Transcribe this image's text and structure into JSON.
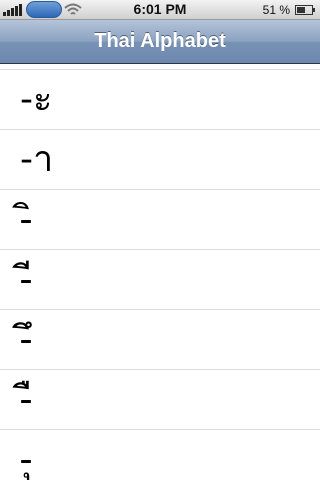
{
  "status_bar": {
    "time": "6:01 PM",
    "battery_percent": "51 %",
    "icons": [
      "signal-bars-icon",
      "wifi-icon",
      "battery-icon"
    ]
  },
  "nav_bar": {
    "title": "Thai Alphabet"
  },
  "list": {
    "items": [
      {
        "glyph": "-ะ"
      },
      {
        "glyph": "-า"
      },
      {
        "glyph": "-ิ"
      },
      {
        "glyph": "-ี"
      },
      {
        "glyph": "-ึ"
      },
      {
        "glyph": "-ื"
      },
      {
        "glyph": "-ุ"
      }
    ]
  }
}
